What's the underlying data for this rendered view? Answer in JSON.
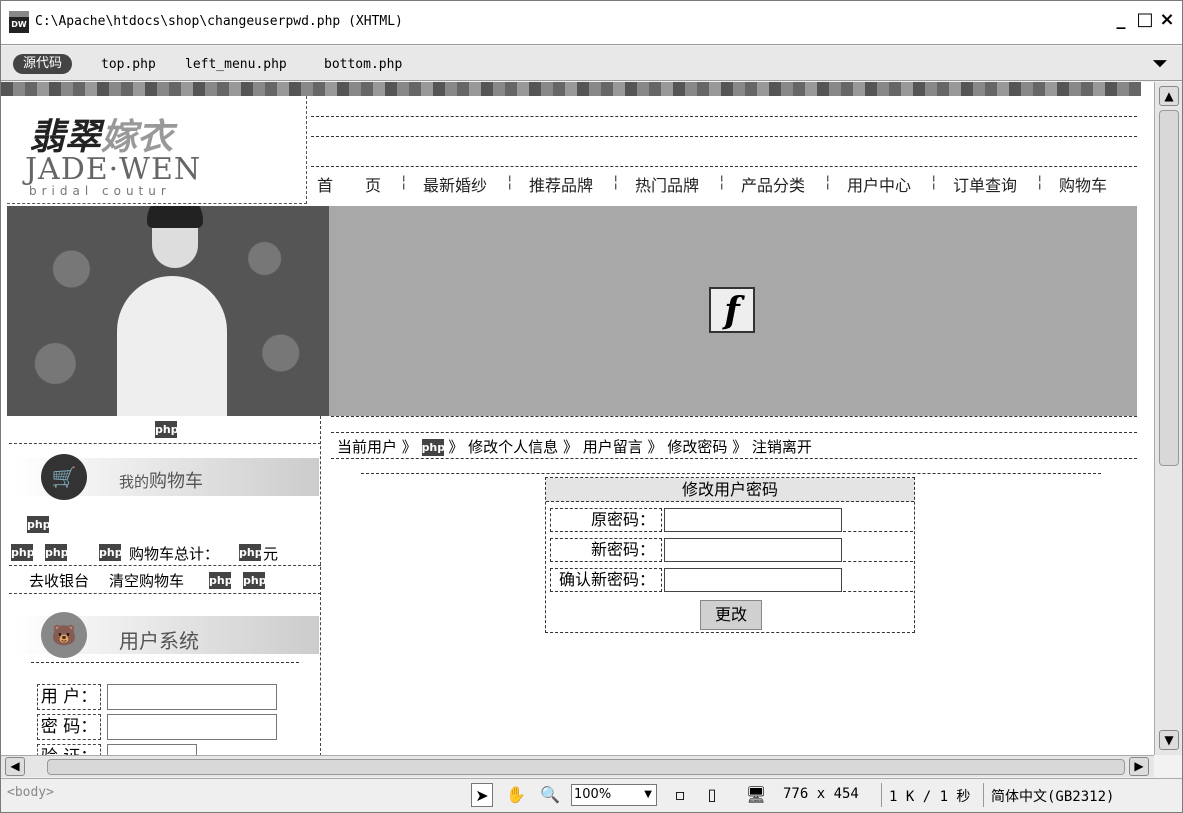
{
  "window": {
    "title": "C:\\Apache\\htdocs\\shop\\changeuserpwd.php (XHTML)",
    "app_icon": "DW",
    "minimize": "_",
    "maximize": "□",
    "close": "×"
  },
  "docbar": {
    "source_button": "源代码",
    "related_files": [
      "top.php",
      "left_menu.php",
      "bottom.php"
    ],
    "filter_icon": "filter-icon"
  },
  "page": {
    "logo_cn_a": "翡翠",
    "logo_cn_b": "嫁衣",
    "logo_en": "JADE·WEN",
    "logo_sub": "bridal coutur",
    "nav": [
      "首　　页",
      "最新婚纱",
      "推荐品牌",
      "热门品牌",
      "产品分类",
      "用户中心",
      "订单查询",
      "购物车"
    ],
    "nav_sep": "¦",
    "flash_glyph": "f",
    "php_marker": "php",
    "cart_title_a": "我的",
    "cart_title_b": "购物车",
    "cart_total": "购物车总计：",
    "yuan": "元",
    "checkout": "去收银台",
    "clear_cart": "清空购物车",
    "user_system": "用户系统",
    "login_user": "用 户：",
    "login_pass": "密 码：",
    "login_verify": "验 证：",
    "breadcrumb": {
      "current_user": "当前用户 》",
      "sep": "》",
      "edit_info": "修改个人信息",
      "message": "用户留言",
      "change_pwd": "修改密码",
      "logout": "注销离开"
    },
    "form": {
      "title": "修改用户密码",
      "old_pwd": "原密码：",
      "new_pwd": "新密码：",
      "confirm_pwd": "确认新密码：",
      "submit": "更改"
    }
  },
  "statusbar": {
    "tag": "<body>",
    "zoom": "100%",
    "dimensions": "776 x 454",
    "size": "1 K / 1 秒",
    "encoding": "简体中文(GB2312)"
  }
}
